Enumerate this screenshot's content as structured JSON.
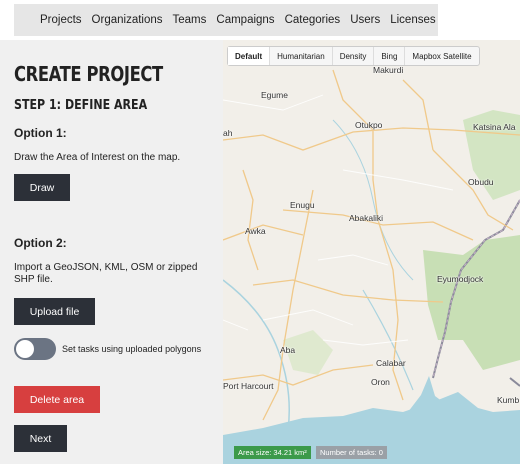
{
  "nav": {
    "items": [
      "Projects",
      "Organizations",
      "Teams",
      "Campaigns",
      "Categories",
      "Users",
      "Licenses"
    ]
  },
  "panel": {
    "title": "CREATE PROJECT",
    "step": "STEP 1: DEFINE AREA",
    "option1_title": "Option 1:",
    "option1_desc": "Draw the Area of Interest on the map.",
    "draw_label": "Draw",
    "option2_title": "Option 2:",
    "option2_desc": "Import a GeoJSON, KML, OSM or zipped SHP file.",
    "upload_label": "Upload file",
    "toggle_label": "Set tasks using uploaded polygons",
    "toggle_on": false,
    "delete_label": "Delete area",
    "next_label": "Next"
  },
  "map": {
    "layers": [
      "Default",
      "Humanitarian",
      "Density",
      "Bing",
      "Mapbox Satellite"
    ],
    "active_layer": "Default",
    "places": [
      "Makurdi",
      "Egume",
      "Otukpo",
      "Katsina Ala",
      "Obudu",
      "Enugu",
      "Abakaliki",
      "Awka",
      "Eyumodjock",
      "Aba",
      "Calabar",
      "Oron",
      "Port Harcourt",
      "Kumb",
      "ah"
    ],
    "area_size": "Area size: 34.21 km²",
    "tasks": "Number of tasks: 0"
  },
  "colors": {
    "dark_button": "#2c3038",
    "delete_button": "#d73f3f",
    "area_badge": "#3c9a4a",
    "water": "#aad3df",
    "forest": "#c8dfb5"
  }
}
